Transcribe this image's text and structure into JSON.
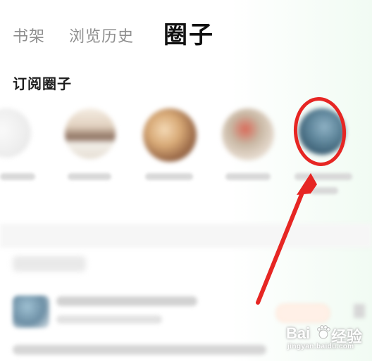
{
  "header": {
    "tabs": [
      {
        "label": "书架",
        "active": false
      },
      {
        "label": "浏览历史",
        "active": false
      },
      {
        "label": "圈子",
        "active": true
      }
    ]
  },
  "subscribed": {
    "title": "订阅圈子"
  },
  "colors": {
    "highlight": "#e62623",
    "active_tab": "#111111",
    "inactive_tab": "#8e8e8e"
  },
  "watermark": {
    "brand_latin": "Bai",
    "brand_suffix": "经验",
    "domain": "jingyan.baidu.com"
  }
}
